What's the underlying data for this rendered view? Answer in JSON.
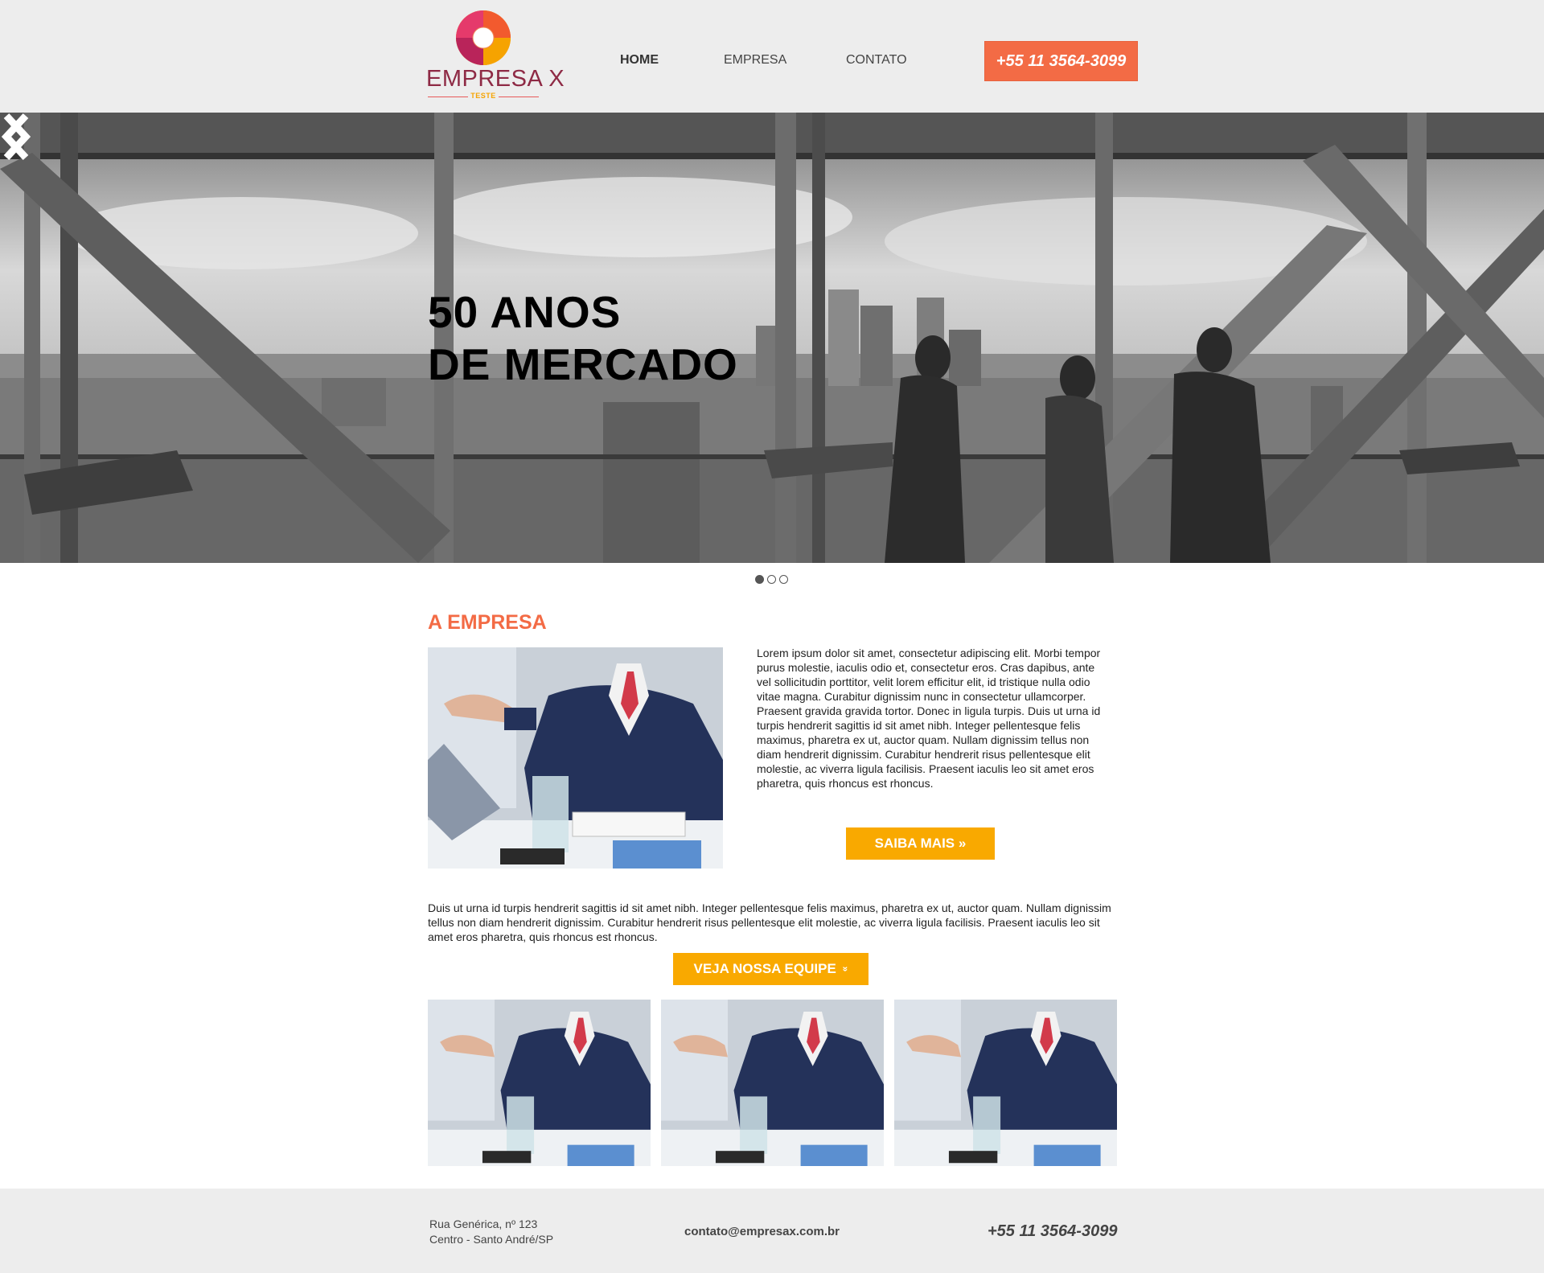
{
  "header": {
    "logo": {
      "name": "EMPRESA X",
      "tagline": "TESTE"
    },
    "nav": [
      {
        "label": "HOME",
        "active": true
      },
      {
        "label": "EMPRESA",
        "active": false
      },
      {
        "label": "CONTATO",
        "active": false
      }
    ],
    "phone_button": "+55 11 3564-3099"
  },
  "hero": {
    "title_line1": "50 ANOS",
    "title_line2": "DE MERCADO",
    "slides": 3,
    "active_slide": 1
  },
  "about": {
    "title": "A EMPRESA",
    "text": "Lorem ipsum dolor sit amet, consectetur adipiscing elit. Morbi tempor purus molestie, iaculis odio et, consectetur eros. Cras dapibus, ante vel sollicitudin porttitor, velit lorem efficitur elit, id tristique nulla odio vitae magna. Curabitur dignissim nunc in consectetur ullamcorper. Praesent gravida gravida tortor. Donec in ligula turpis. Duis ut urna id turpis hendrerit sagittis id sit amet nibh. Integer pellentesque felis maximus, pharetra ex ut, auctor quam. Nullam dignissim tellus non diam hendrerit dignissim. Curabitur hendrerit risus pellentesque elit molestie, ac viverra ligula facilisis. Praesent iaculis leo sit amet eros pharetra, quis rhoncus est rhoncus.",
    "button": "SAIBA MAIS »",
    "text2": "Duis ut urna id turpis hendrerit sagittis id sit amet nibh. Integer pellentesque felis maximus, pharetra ex ut, auctor quam. Nullam dignissim tellus non diam hendrerit dignissim. Curabitur hendrerit risus pellentesque elit molestie, ac viverra ligula facilisis. Praesent iaculis leo sit amet eros pharetra, quis rhoncus est rhoncus.",
    "team_button": "VEJA NOSSA EQUIPE",
    "team_button_icon": "»"
  },
  "footer": {
    "address_line1": "Rua Genérica, nº 123",
    "address_line2": "Centro - Santo André/SP",
    "email": "contato@empresax.com.br",
    "phone": "+55 11 3564-3099"
  },
  "colors": {
    "accent_orange": "#f36b45",
    "button_yellow": "#f9a900",
    "header_bg": "#ededed",
    "logo_text": "#8e2a45"
  }
}
